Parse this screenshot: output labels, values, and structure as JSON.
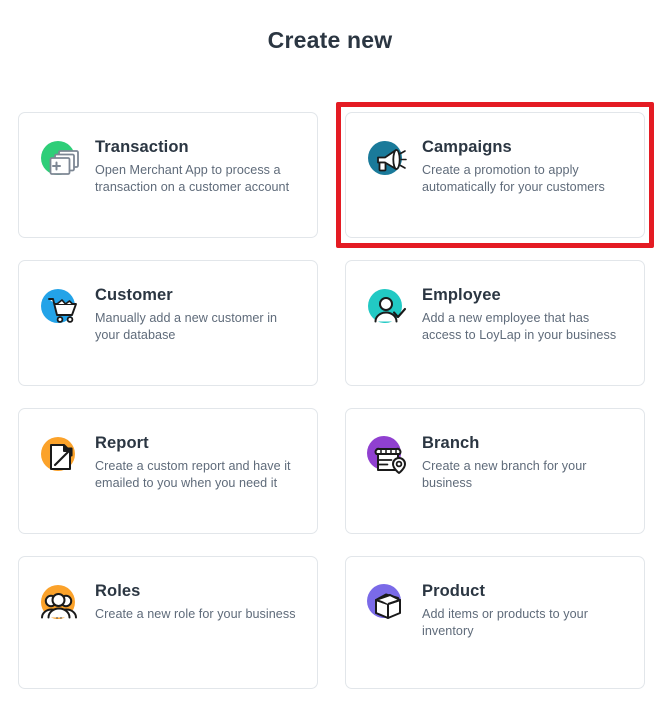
{
  "header": {
    "title": "Create new"
  },
  "theme": {
    "page_background": "#ffffff",
    "title_color": "#2b3642",
    "card_border": "#e2e6ea",
    "card_background": "#ffffff",
    "description_color": "#5f6b7a",
    "highlight_color": "#e41b23"
  },
  "cards": [
    {
      "title": "Transaction",
      "description": "Open Merchant App to process a transaction on a customer account",
      "icon": "stacked-cards-plus-icon",
      "icon_color": "#2ece78",
      "highlighted": false
    },
    {
      "title": "Campaigns",
      "description": "Create a promotion to apply automatically for your customers",
      "icon": "megaphone-icon",
      "icon_color": "#1a7a9a",
      "highlighted": true
    },
    {
      "title": "Customer",
      "description": "Manually add a new customer in your database",
      "icon": "shopping-cart-icon",
      "icon_color": "#23a3e8",
      "highlighted": false
    },
    {
      "title": "Employee",
      "description": "Add a new employee that has access to LoyLap in your business",
      "icon": "person-check-icon",
      "icon_color": "#22c9c4",
      "highlighted": false
    },
    {
      "title": "Report",
      "description": "Create a custom report and have it emailed to you when you need it",
      "icon": "document-arrow-icon",
      "icon_color": "#fba22a",
      "highlighted": false
    },
    {
      "title": "Branch",
      "description": "Create a new branch for your business",
      "icon": "storefront-pin-icon",
      "icon_color": "#9040d0",
      "highlighted": false
    },
    {
      "title": "Roles",
      "description": "Create a new role for your business",
      "icon": "people-group-icon",
      "icon_color": "#fba22a",
      "highlighted": false
    },
    {
      "title": "Product",
      "description": "Add items or products to your inventory",
      "icon": "open-box-icon",
      "icon_color": "#7a6ae8",
      "highlighted": false
    }
  ]
}
